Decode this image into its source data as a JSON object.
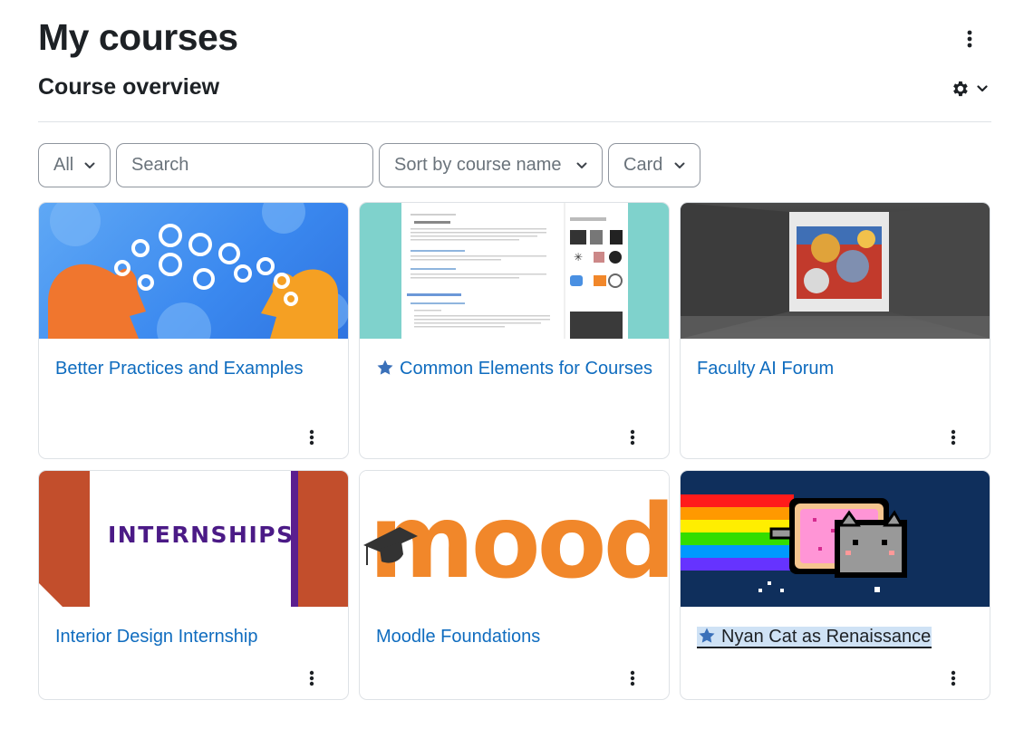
{
  "page": {
    "title": "My courses"
  },
  "overview": {
    "title": "Course overview"
  },
  "filters": {
    "grouping": "All",
    "search_placeholder": "Search",
    "sort": "Sort by course name",
    "view": "Card"
  },
  "courses": [
    {
      "name": "Better Practices and Examples",
      "starred": false
    },
    {
      "name": "Common Elements for Courses",
      "starred": true
    },
    {
      "name": "Faculty AI Forum",
      "starred": false
    },
    {
      "name": "Interior Design Internship",
      "starred": false,
      "image_text": "INTERNSHIPS"
    },
    {
      "name": "Moodle Foundations",
      "starred": false,
      "image_text": "moodle"
    },
    {
      "name": "Nyan Cat as Renaissance",
      "starred": true
    }
  ],
  "icons": {
    "page_menu": "vertical-dots-icon",
    "settings": "gear-icon",
    "dropdown": "chevron-down-icon",
    "favourite": "star-icon",
    "course_menu": "vertical-dots-icon"
  },
  "colors": {
    "link": "#0f6cbf",
    "star": "#3a70b9",
    "text": "#1d2125",
    "border": "#dee2e6"
  }
}
